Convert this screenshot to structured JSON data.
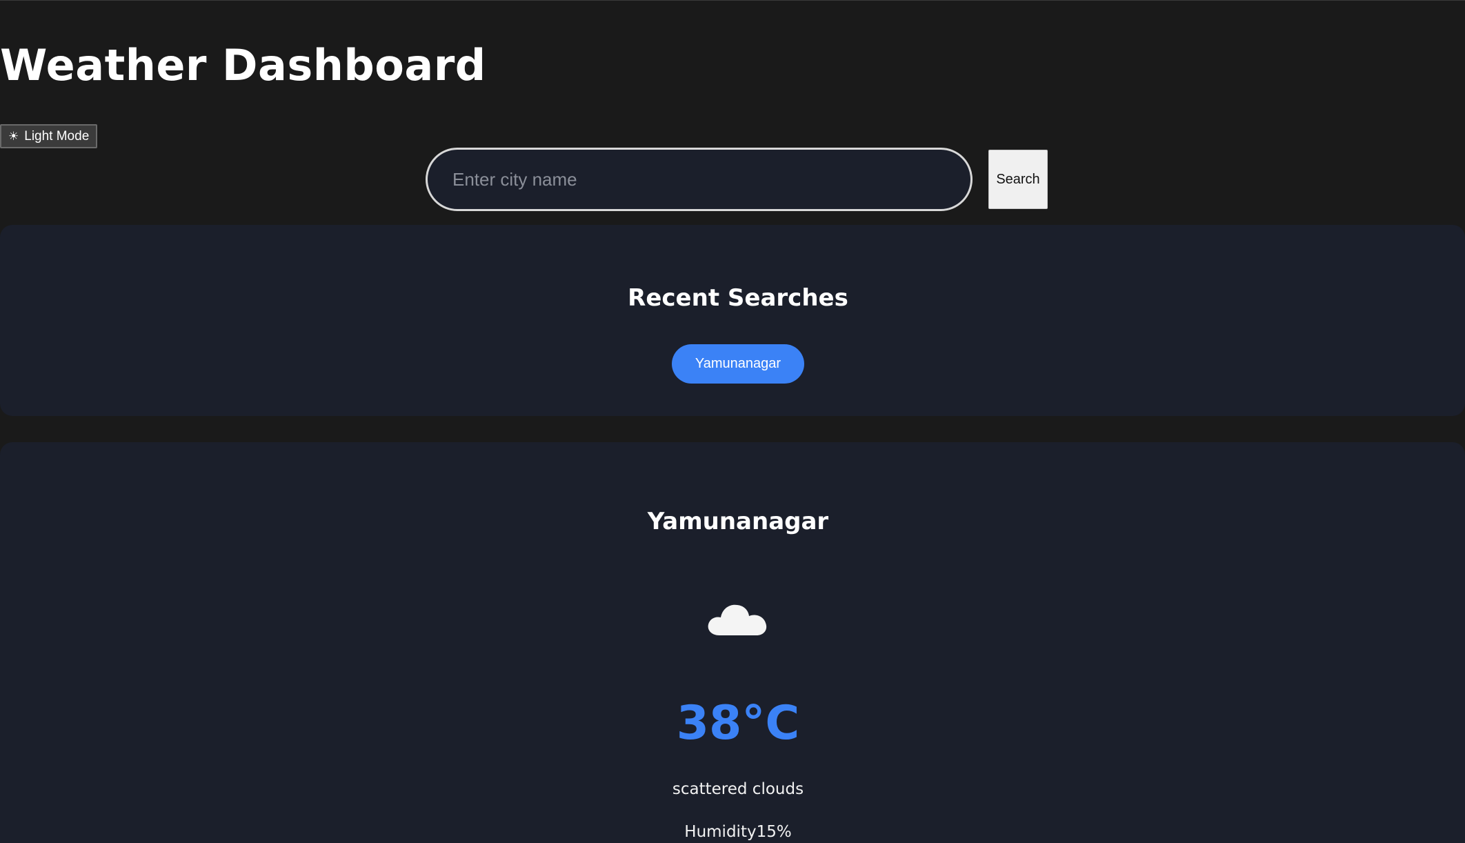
{
  "header": {
    "title": "Weather Dashboard",
    "theme_toggle_icon": "☀",
    "theme_toggle_label": "Light Mode"
  },
  "search": {
    "placeholder": "Enter city name",
    "value": "",
    "button_label": "Search"
  },
  "recent": {
    "title": "Recent Searches",
    "items": [
      "Yamunanagar"
    ]
  },
  "weather": {
    "city": "Yamunanagar",
    "icon": "cloud-icon",
    "temperature": "38°C",
    "description": "scattered clouds",
    "humidity_label": "Humidity",
    "humidity_value": "15%"
  },
  "colors": {
    "background": "#1a1a1a",
    "panel": "#1b1f2b",
    "accent": "#3b82f6"
  }
}
